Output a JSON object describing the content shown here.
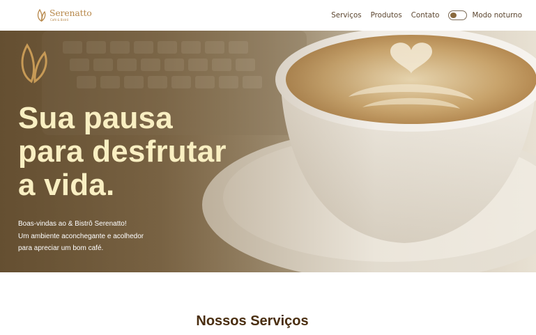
{
  "brand": {
    "name": "Serenatto",
    "subtitle": "Café & Bistrô",
    "accent_color": "#b8894c",
    "logo_icon": "leaf-logo-icon"
  },
  "nav": {
    "items": [
      "Serviços",
      "Produtos",
      "Contato"
    ],
    "dark_mode_label": "Modo noturno",
    "dark_mode_on": false
  },
  "hero": {
    "title_line1": "Sua pausa",
    "title_line2_regular": "para ",
    "title_line2_bold": "desfrutar",
    "title_line3": "a vida.",
    "text_lines": [
      "Boas-vindas ao & Bistrô Serenatto!",
      "Um ambiente aconchegante e acolhedor",
      "para apreciar um bom café."
    ],
    "title_color": "#f9efc2"
  },
  "services": {
    "title": "Nossos Serviços"
  }
}
